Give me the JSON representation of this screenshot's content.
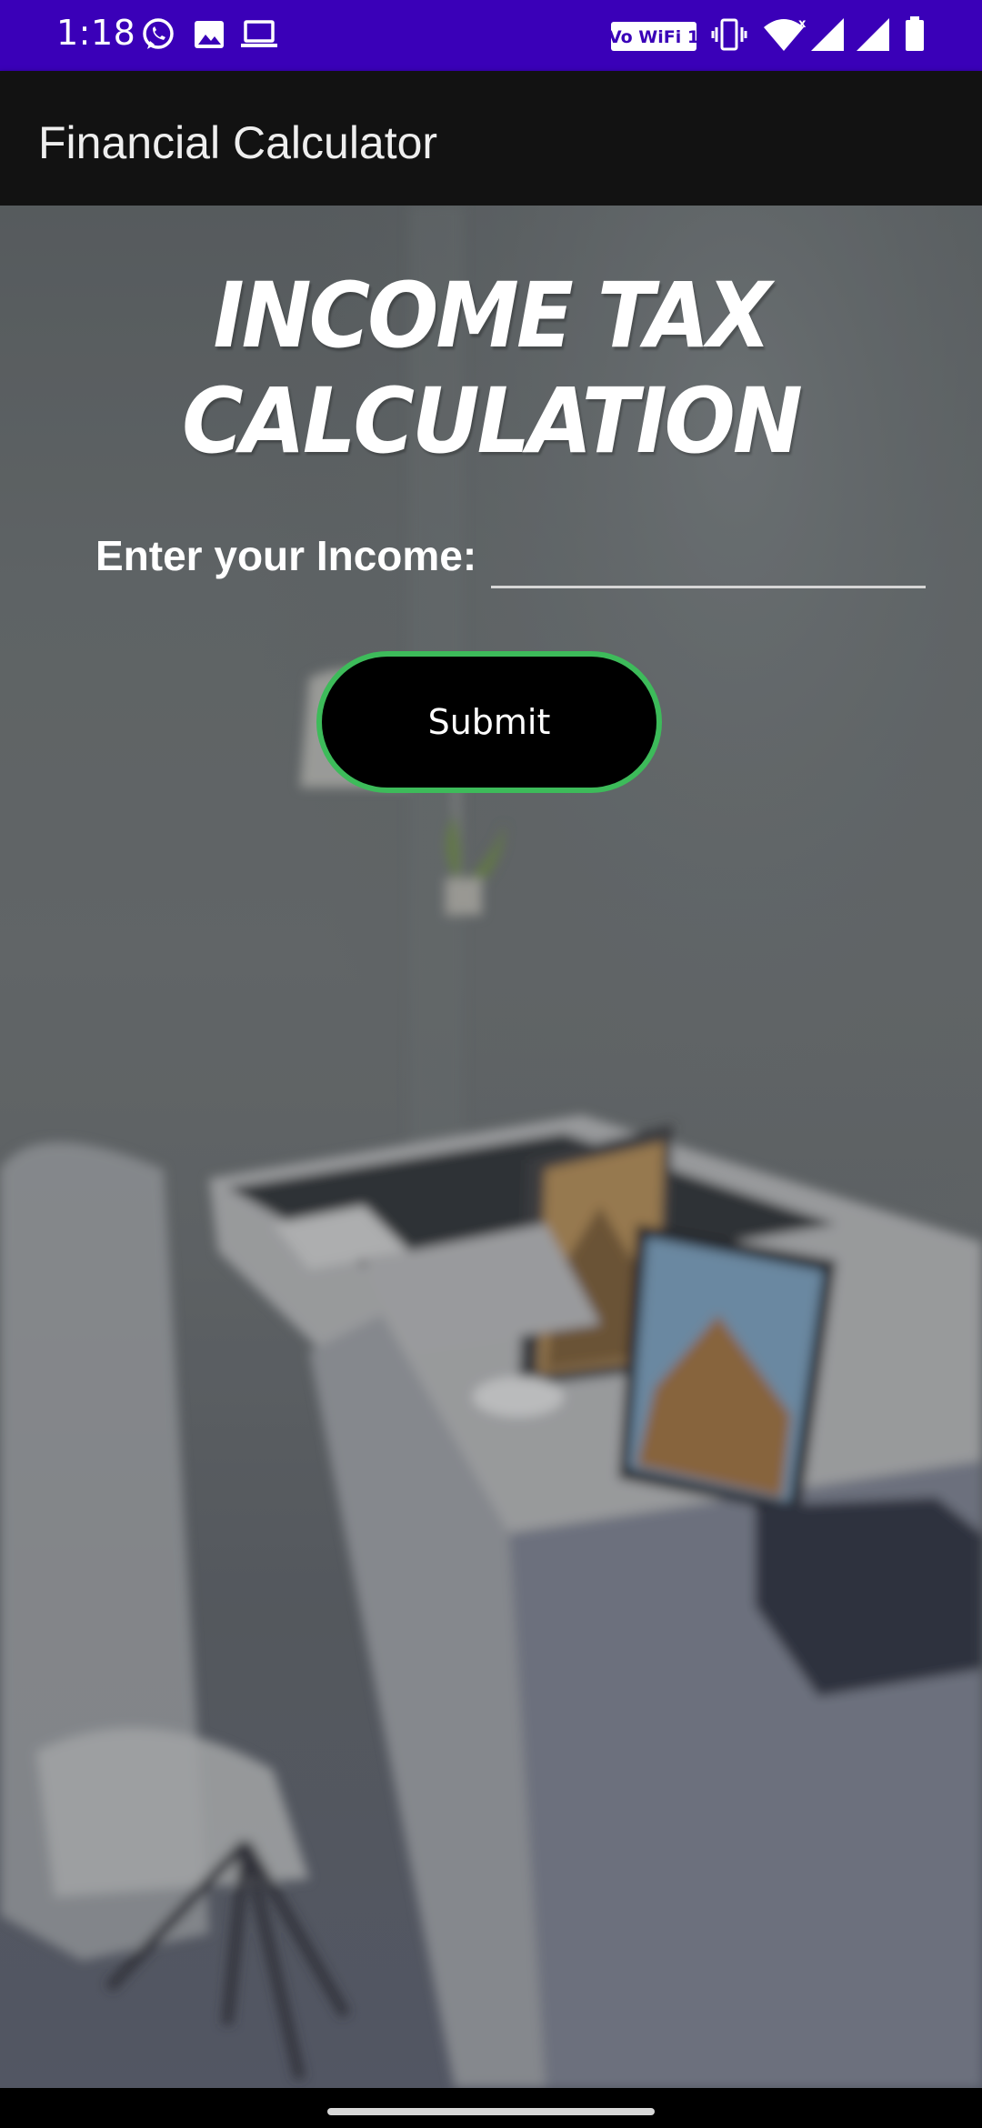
{
  "status_bar": {
    "time": "1:18",
    "wifi_badge": "Vo WiFi 1",
    "icons": [
      "whatsapp-icon",
      "gallery-icon",
      "laptop-icon",
      "vowifi-icon",
      "vibrate-icon",
      "wifi-icon",
      "signal-icon",
      "signal-icon",
      "battery-icon"
    ],
    "color": "#3a00b8"
  },
  "app_bar": {
    "title": "Financial Calculator",
    "color": "#121212"
  },
  "main": {
    "heading": "INCOME TAX CALCULATION",
    "income_label": "Enter your Income:",
    "income_value": "",
    "submit_label": "Submit",
    "button_border_color": "#3dbb5a"
  }
}
